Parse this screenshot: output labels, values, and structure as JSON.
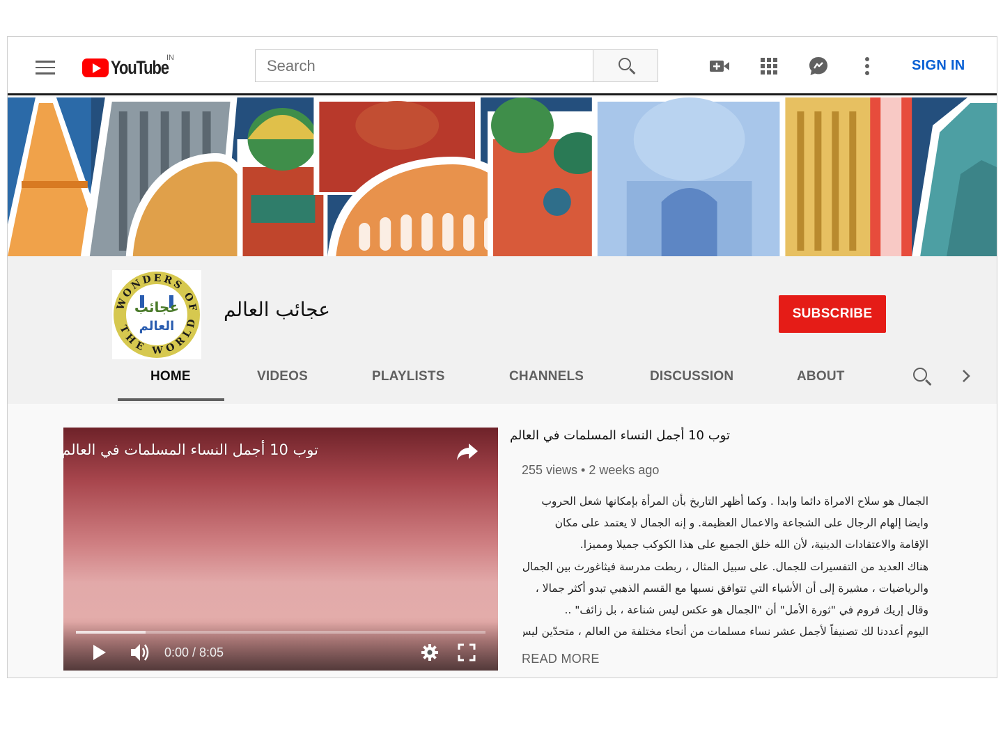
{
  "masthead": {
    "logo_text": "YouTube",
    "country_code": "IN",
    "search_placeholder": "Search",
    "icons": [
      "menu-icon",
      "create-video-icon",
      "apps-icon",
      "messages-icon",
      "more-vert-icon"
    ],
    "sign_in_label": "SIGN IN"
  },
  "channel": {
    "name": "عجائب العالم",
    "avatar_text_en": "WONDERS OF THE WORLD",
    "avatar_text_ar": "عجائب العالم",
    "subscribe_label": "SUBSCRIBE",
    "tabs": [
      {
        "label": "HOME",
        "active": true
      },
      {
        "label": "VIDEOS"
      },
      {
        "label": "PLAYLISTS"
      },
      {
        "label": "CHANNELS"
      },
      {
        "label": "DISCUSSION"
      },
      {
        "label": "ABOUT"
      }
    ]
  },
  "featured_video": {
    "player_title": "توب 10 أجمل النساء المسلمات في العالم",
    "title": "توب 10 أجمل النساء المسلمات في العالم",
    "time_display": "0:00 / 8:05",
    "progress_buffered": 0.17,
    "meta": "255 views • 2 weeks ago",
    "description": [
      "الجمال هو سلاح الامراة دائما وابدا . وكما أظهر التاريخ بأن المرأة بإمكانها شعل الحروب",
      "وايضا إلهام الرجال على الشجاعة والاعمال العظيمة. و إنه الجمال لا يعتمد على مكان",
      "الإقامة والاعتقادات الدينية، لأن الله خلق الجميع على هذا الكوكب جميلا ومميزا.",
      "هناك العديد من التفسيرات للجمال. على سبيل المثال ، ربطت مدرسة فيثاغورث بين الجمال",
      "والرياضيات ، مشيرة إلى أن الأشياء التي تتوافق نسبها مع القسم الذهبي تبدو أكثر جمالا ،",
      "وقال إريك فروم في \"ثورة الأمل\" أن \"الجمال هو عكس ليس شناعة ، بل زائف\" ..",
      "اليوم أعددنا لك تصنيفاً لأجمل عشر نساء مسلمات من أنحاء مختلفة من العالم ، متحدّين ليس"
    ],
    "read_more_label": "READ MORE"
  },
  "colors": {
    "brand_red": "#ff0000",
    "subscribe_red": "#e51c17",
    "link_blue": "#065fd4"
  }
}
